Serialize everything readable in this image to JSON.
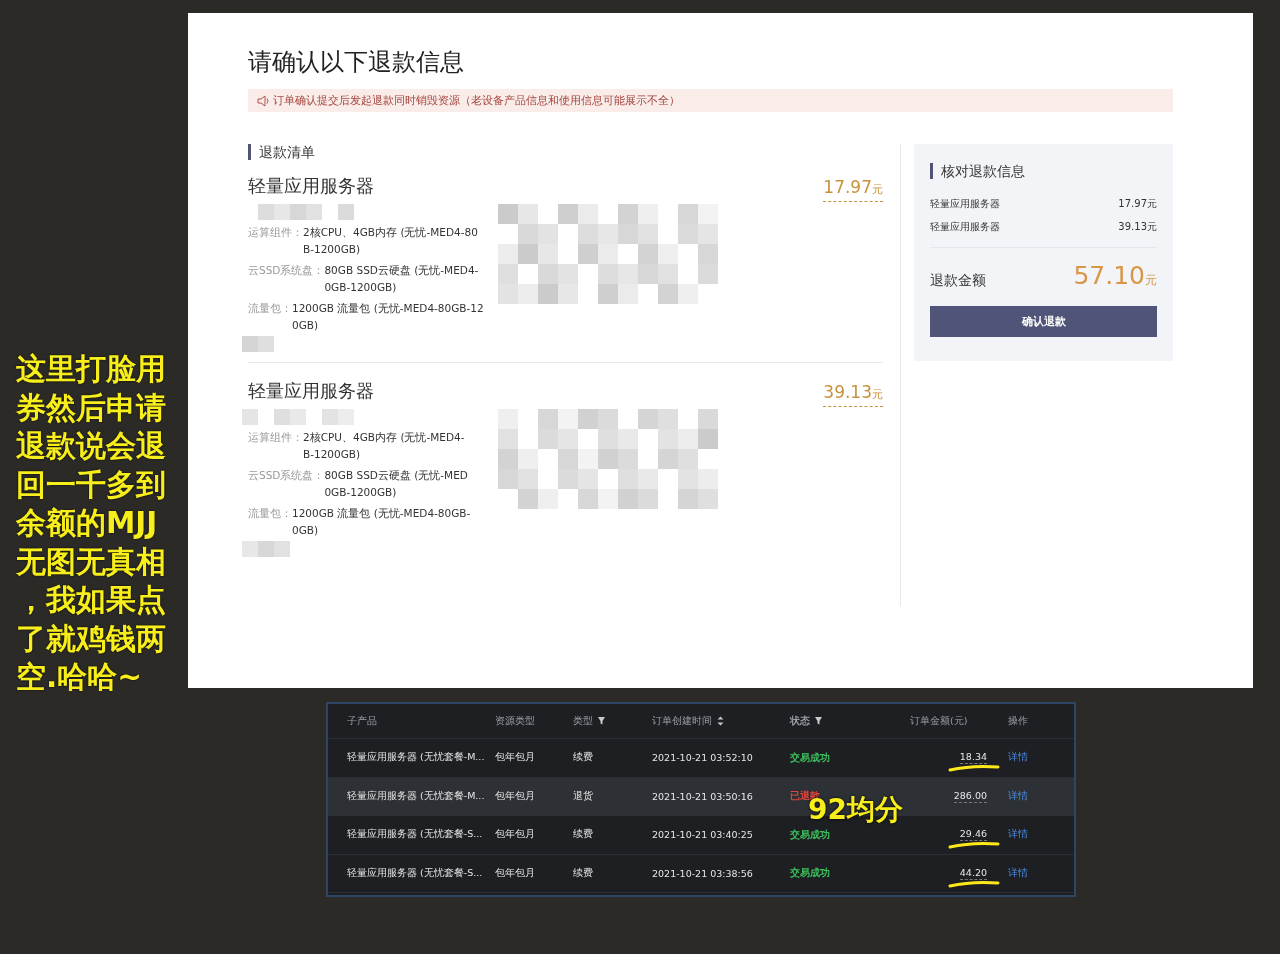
{
  "caption": "这里打脸用券然后申请退款说会退回一千多到余额的MJJ无图无真相，我如果点了就鸡钱两空.哈哈~",
  "dialog": {
    "title": "请确认以下退款信息",
    "notice": "订单确认提交后发起退款同时销毁资源（老设备产品信息和使用信息可能展示不全）",
    "list_heading": "退款清单",
    "items": [
      {
        "name": "轻量应用服务器",
        "price": "17.97",
        "unit": "元",
        "specs": [
          {
            "label": "运算组件：",
            "lines": [
              "2核CPU、4GB内存 (无忧-MED4-80",
              "B-1200GB)"
            ]
          },
          {
            "label": "云SSD系统盘：",
            "lines": [
              "80GB SSD云硬盘 (无忧-MED4-",
              "0GB-1200GB)"
            ]
          },
          {
            "label": "流量包：",
            "lines": [
              "1200GB 流量包 (无忧-MED4-80GB-12",
              "0GB)"
            ]
          }
        ]
      },
      {
        "name": "轻量应用服务器",
        "price": "39.13",
        "unit": "元",
        "specs": [
          {
            "label": "运算组件：",
            "lines": [
              "2核CPU、4GB内存 (无忧-MED4-",
              "B-1200GB)"
            ]
          },
          {
            "label": "云SSD系统盘：",
            "lines": [
              "80GB SSD云硬盘 (无忧-MED",
              "0GB-1200GB)"
            ]
          },
          {
            "label": "流量包：",
            "lines": [
              "1200GB 流量包 (无忧-MED4-80GB-",
              "0GB)"
            ]
          }
        ]
      }
    ],
    "summary": {
      "heading": "核对退款信息",
      "rows": [
        {
          "name": "轻量应用服务器",
          "amount": "17.97元"
        },
        {
          "name": "轻量应用服务器",
          "amount": "39.13元"
        }
      ],
      "total_label": "退款金额",
      "total": "57.10",
      "unit": "元",
      "button": "确认退款"
    }
  },
  "orders": {
    "columns": [
      {
        "label": "子产品",
        "kind": "plain"
      },
      {
        "label": "资源类型",
        "kind": "plain"
      },
      {
        "label": "类型",
        "kind": "filter"
      },
      {
        "label": "订单创建时间",
        "kind": "sort"
      },
      {
        "label": "状态",
        "kind": "filter"
      },
      {
        "label": "订单金额(元)",
        "kind": "plain"
      },
      {
        "label": "操作",
        "kind": "plain"
      }
    ],
    "rows": [
      {
        "product": "轻量应用服务器 (无忧套餐-M...",
        "resource": "包年包月",
        "type": "续费",
        "time": "2021-10-21 03:52:10",
        "status": "交易成功",
        "color": "#3dbe5c",
        "amount": "18.34",
        "action": "详情",
        "highlighted": false,
        "marked": true
      },
      {
        "product": "轻量应用服务器 (无忧套餐-M...",
        "resource": "包年包月",
        "type": "退货",
        "time": "2021-10-21 03:50:16",
        "status": "已退款",
        "color": "#e0443c",
        "amount": "286.00",
        "action": "详情",
        "highlighted": true,
        "marked": false
      },
      {
        "product": "轻量应用服务器 (无忧套餐-S...",
        "resource": "包年包月",
        "type": "续费",
        "time": "2021-10-21 03:40:25",
        "status": "交易成功",
        "color": "#3dbe5c",
        "amount": "29.46",
        "action": "详情",
        "highlighted": false,
        "marked": true
      },
      {
        "product": "轻量应用服务器 (无忧套餐-S...",
        "resource": "包年包月",
        "type": "续费",
        "time": "2021-10-21 03:38:56",
        "status": "交易成功",
        "color": "#3dbe5c",
        "amount": "44.20",
        "action": "详情",
        "highlighted": false,
        "marked": true
      }
    ],
    "annotation": "92均分"
  }
}
